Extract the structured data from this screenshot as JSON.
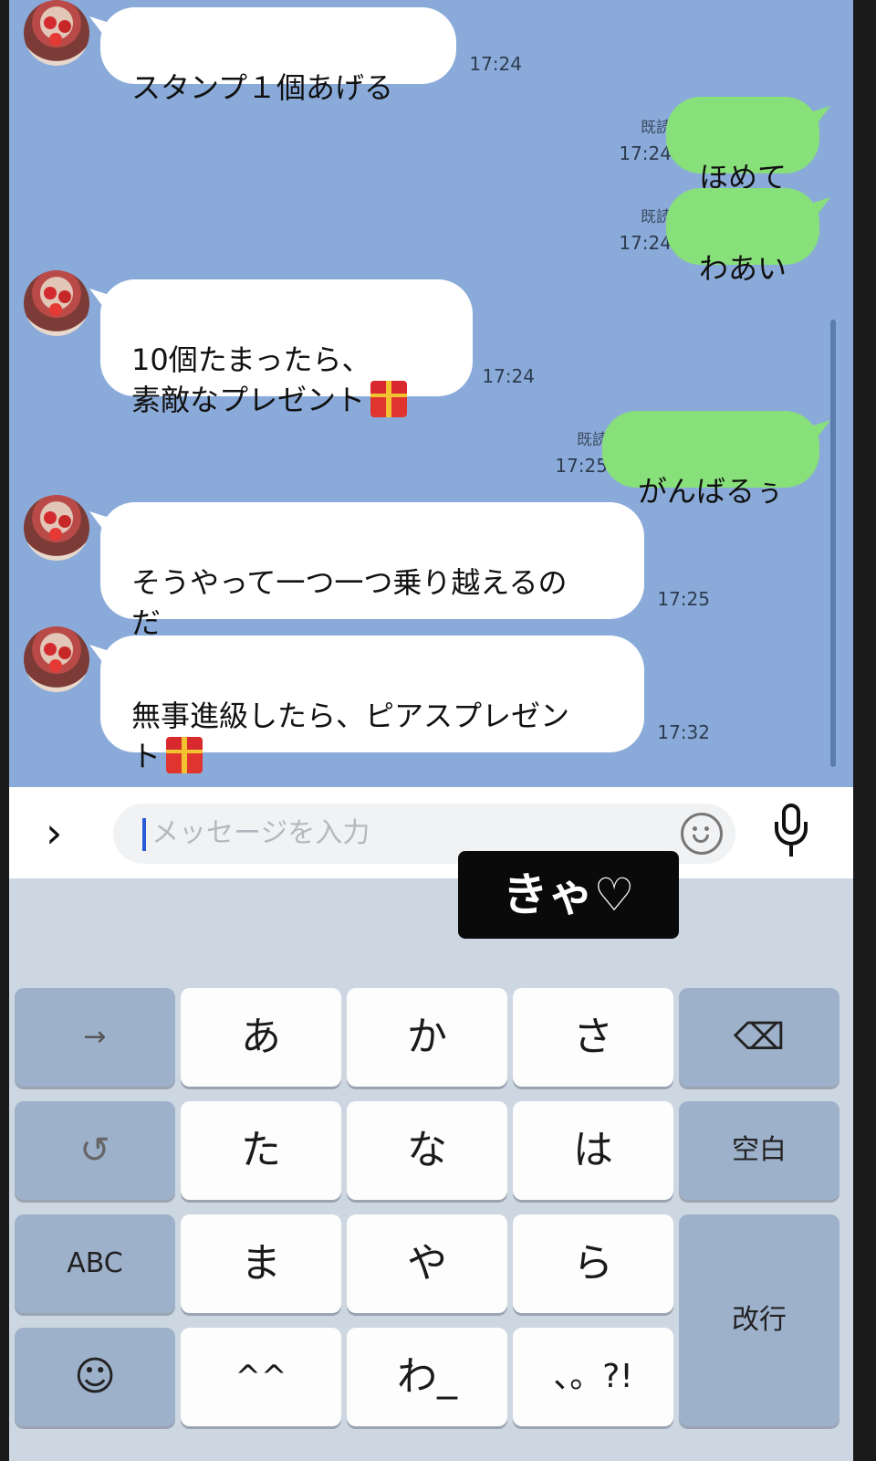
{
  "messages": [
    {
      "dir": "in",
      "text": "スタンプ１個あげる",
      "time": "17:24"
    },
    {
      "dir": "out",
      "text": "ほめて",
      "read": "既読",
      "time": "17:24"
    },
    {
      "dir": "out",
      "text": "わあい",
      "read": "既読",
      "time": "17:24"
    },
    {
      "dir": "in",
      "text": "10個たまったら、\n素敵なプレゼント",
      "time": "17:24",
      "emoji": "gift-icon"
    },
    {
      "dir": "out",
      "text": "がんばるぅ",
      "read": "既読",
      "time": "17:25"
    },
    {
      "dir": "in",
      "text": "そうやって一つ一つ乗り越えるの\nだ",
      "time": "17:25"
    },
    {
      "dir": "in",
      "text": "無事進級したら、ピアスプレゼン\nト",
      "time": "17:32",
      "emoji": "gift-icon"
    }
  ],
  "input": {
    "placeholder": "メッセージを入力"
  },
  "overlay": {
    "sticker_text": "きゃ♡"
  },
  "keyboard": {
    "keys": [
      "→",
      "あ",
      "か",
      "さ",
      "⌫",
      "↺",
      "た",
      "な",
      "は",
      "空白",
      "ABC",
      "ま",
      "や",
      "ら",
      "改行",
      "☺",
      "^^",
      "わ_",
      "、。?!"
    ]
  },
  "colors": {
    "chat_bg": "#8aabd9",
    "outgoing": "#88e07a",
    "incoming": "#ffffff",
    "keyboard_bg": "#cdd7e2",
    "caret": "#2b5cd6"
  }
}
